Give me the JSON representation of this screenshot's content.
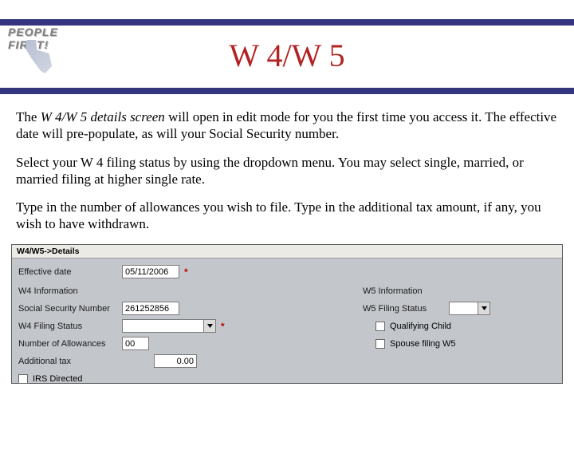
{
  "logo": {
    "line1": "PEOPLE",
    "line2": "FIRST!"
  },
  "title": "W 4/W 5",
  "paragraphs": {
    "p1a": "The ",
    "p1b": "W 4/W 5 details screen",
    "p1c": " will open in edit mode for you the first time you access it.  The effective date will pre-populate, as will your Social Security number.",
    "p2": "Select your W 4 filing status by using the dropdown menu.  You may select single, married, or married filing at higher single rate.",
    "p3": "Type in the number of allowances you wish to file. Type in the additional tax amount, if any, you wish to have withdrawn."
  },
  "app": {
    "title": "W4/W5->Details",
    "required": "*",
    "left": {
      "effective_date_label": "Effective date",
      "effective_date_value": "05/11/2006",
      "w4_info_label": "W4 Information",
      "ssn_label": "Social Security Number",
      "ssn_value": "261252856",
      "filing_status_label": "W4 Filing Status",
      "allowances_label": "Number of Allowances",
      "allowances_value": "00",
      "additional_tax_label": "Additional tax",
      "additional_tax_value": "0.00",
      "irs_directed_label": "IRS Directed"
    },
    "right": {
      "w5_info_label": "W5 Information",
      "w5_filing_status_label": "W5 Filing Status",
      "qualifying_child_label": "Qualifying Child",
      "spouse_filing_label": "Spouse filing W5"
    }
  }
}
